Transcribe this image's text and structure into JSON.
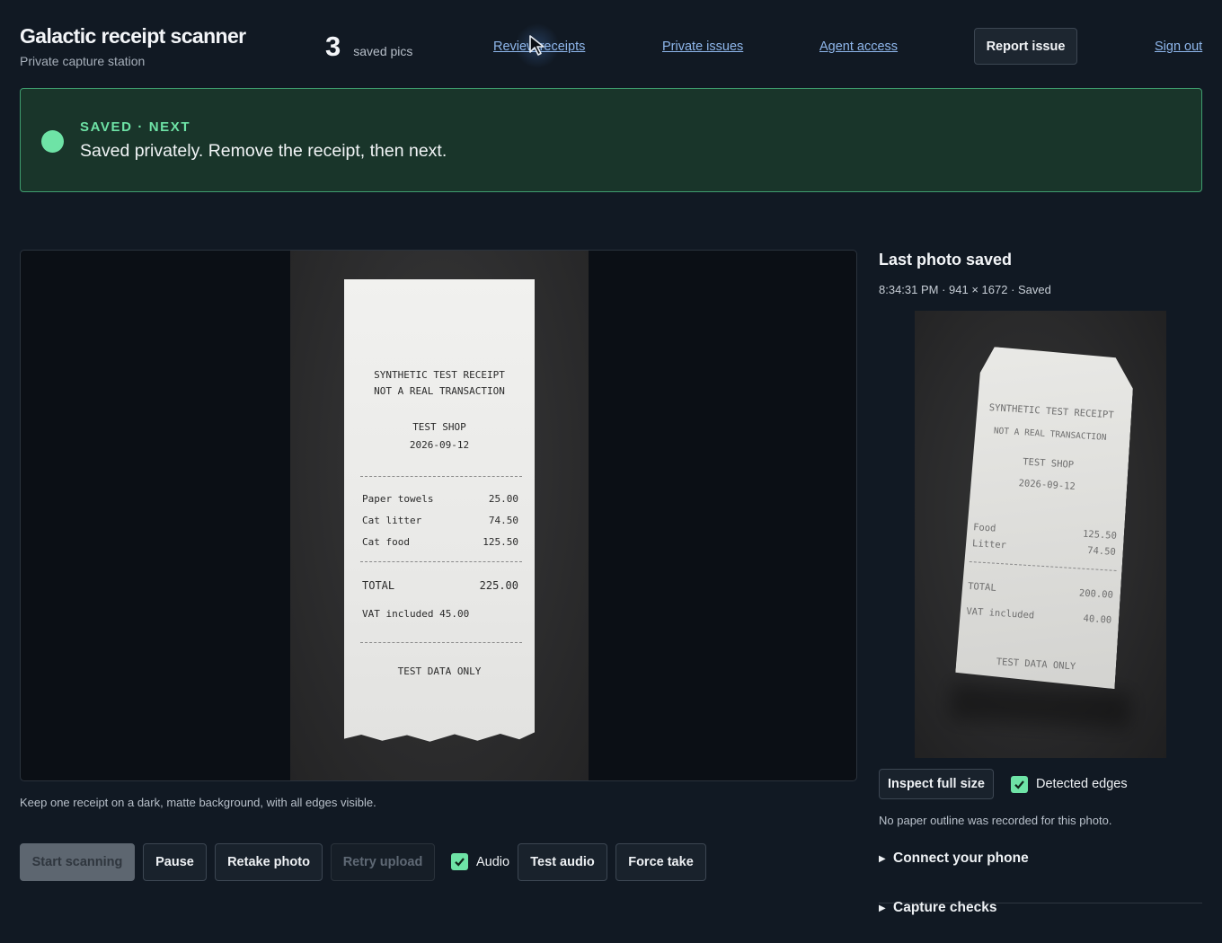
{
  "header": {
    "title": "Galactic receipt scanner",
    "subtitle": "Private capture station",
    "saved_count": "3",
    "saved_label": "saved pics",
    "nav": {
      "review": "Review receipts",
      "issues": "Private issues",
      "agent": "Agent access",
      "report": "Report issue",
      "signout": "Sign out"
    }
  },
  "banner": {
    "kicker": "SAVED · NEXT",
    "message": "Saved privately. Remove the receipt, then next.",
    "accent": "#6ee3a6"
  },
  "camera": {
    "receipt": {
      "line1": "SYNTHETIC TEST RECEIPT",
      "line2": "NOT A REAL TRANSACTION",
      "shop": "TEST SHOP",
      "date": "2026-09-12",
      "items": [
        {
          "name": "Paper towels",
          "price": "25.00"
        },
        {
          "name": "Cat litter",
          "price": "74.50"
        },
        {
          "name": "Cat food",
          "price": "125.50"
        }
      ],
      "total_label": "TOTAL",
      "total_value": "225.00",
      "vat": "VAT included 45.00",
      "footer": "TEST DATA ONLY"
    },
    "hint": "Keep one receipt on a dark, matte background, with all edges visible."
  },
  "controls": {
    "start": "Start scanning",
    "pause": "Pause",
    "retake": "Retake photo",
    "retry": "Retry upload",
    "audio_label": "Audio",
    "audio_checked": true,
    "test_audio": "Test audio",
    "force": "Force take"
  },
  "last_photo": {
    "title": "Last photo saved",
    "meta": "8:34:31 PM · 941 × 1672 · Saved",
    "receipt": {
      "line1": "SYNTHETIC TEST RECEIPT",
      "line2": "NOT A REAL TRANSACTION",
      "shop": "TEST SHOP",
      "date": "2026-09-12",
      "items": [
        {
          "name": "Food",
          "price": "125.50"
        },
        {
          "name": "Litter",
          "price": "74.50"
        }
      ],
      "total_label": "TOTAL",
      "total_value": "200.00",
      "vat_label": "VAT included",
      "vat_value": "40.00",
      "footer": "TEST DATA ONLY"
    },
    "inspect": "Inspect full size",
    "edges_label": "Detected edges",
    "edges_checked": true,
    "note": "No paper outline was recorded for this photo.",
    "sections": [
      "Connect your phone",
      "Capture checks"
    ]
  }
}
